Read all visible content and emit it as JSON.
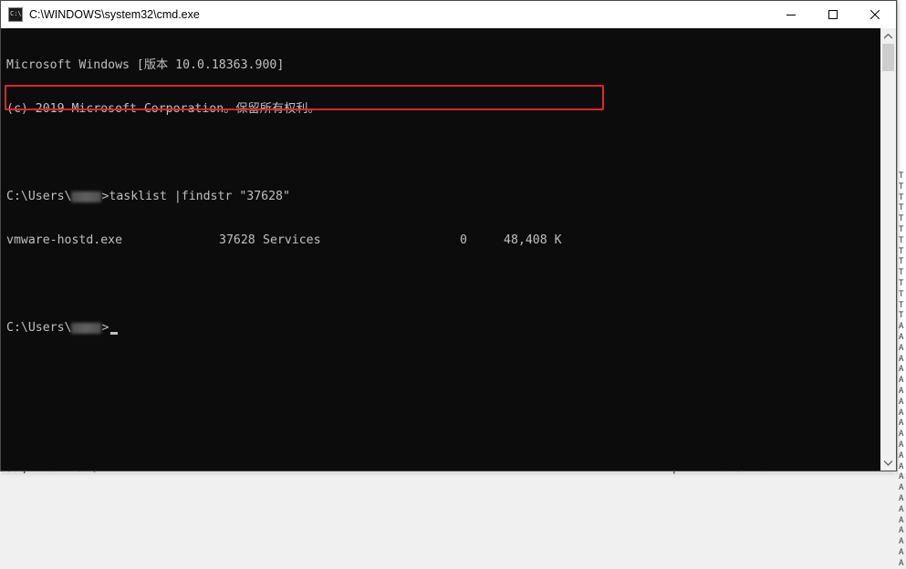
{
  "window": {
    "title": "C:\\WINDOWS\\system32\\cmd.exe",
    "icon_label": "C:\\",
    "buttons": [
      "minimize",
      "maximize",
      "close"
    ]
  },
  "console": {
    "banner_line1": "Microsoft Windows [版本 10.0.18363.900]",
    "banner_line2": "(c) 2019 Microsoft Corporation。保留所有权利。",
    "cmd_prefix": "C:\\Users\\",
    "cmd_suffix": ">tasklist |findstr \"37628\"",
    "result": {
      "image_name": "vmware-hostd.exe",
      "pid": "37628",
      "session_name": "Services",
      "session_num": "0",
      "mem_usage": "48,408 K"
    },
    "prompt_prefix": "C:\\Users\\",
    "prompt_suffix": ">"
  },
  "background": {
    "bottom_left_text": "查看该pid对应的程序:",
    "bottom_right_text": "tasklist |findstr \"进程id号\"",
    "left_marks": [
      "8",
      "秘",
      "在",
      "ro"
    ],
    "right_chars": [
      "T",
      "T",
      "T",
      "T",
      "T",
      "T",
      "T",
      "T",
      "T",
      "T",
      "T",
      "T",
      "T",
      "T",
      "A",
      "A",
      "A",
      "A",
      "A",
      "A",
      "A",
      "A",
      "A",
      "A",
      "A",
      "A",
      "A",
      "A",
      "A",
      "A",
      "A",
      "A",
      "A",
      "A",
      "A",
      "A",
      "A"
    ]
  },
  "colors": {
    "console_bg": "#0c0c0c",
    "console_fg": "#c0c0c0",
    "highlight": "#e8242a"
  }
}
